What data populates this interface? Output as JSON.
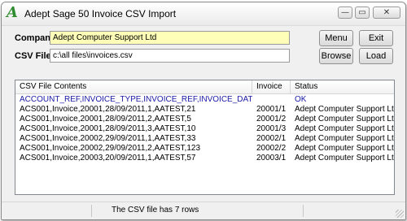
{
  "window": {
    "title": "Adept Sage 50 Invoice CSV Import",
    "icon": "adept-logo-icon"
  },
  "titlebar_buttons": {
    "minimize": "—",
    "restore": "▭",
    "close": "✕"
  },
  "form": {
    "company_label": "Company",
    "company_value": "Adept Computer Support Ltd",
    "csvfile_label": "CSV File",
    "csvfile_value": "c:\\all files\\invoices.csv"
  },
  "buttons": {
    "menu": "Menu",
    "exit": "Exit",
    "browse": "Browse",
    "load": "Load"
  },
  "table": {
    "columns": [
      "CSV File Contents",
      "Invoice",
      "Status"
    ],
    "rows": [
      {
        "contents": "ACCOUNT_REF,INVOICE_TYPE,INVOICE_REF,INVOICE_DATE,ITEM_N...",
        "invoice": "",
        "status": "OK",
        "highlight": true
      },
      {
        "contents": "ACS001,Invoice,20001,28/09/2011,1,AATEST,21",
        "invoice": "20001/1",
        "status": "Adept Computer Support Ltd"
      },
      {
        "contents": "ACS001,Invoice,20001,28/09/2011,2,AATEST,5",
        "invoice": "20001/2",
        "status": "Adept Computer Support Ltd"
      },
      {
        "contents": "ACS001,Invoice,20001,28/09/2011,3,AATEST,10",
        "invoice": "20001/3",
        "status": "Adept Computer Support Ltd"
      },
      {
        "contents": "ACS001,Invoice,20002,29/09/2011,1,AATEST,33",
        "invoice": "20002/1",
        "status": "Adept Computer Support Ltd"
      },
      {
        "contents": "ACS001,Invoice,20002,29/09/2011,2,AATEST,123",
        "invoice": "20002/2",
        "status": "Adept Computer Support Ltd"
      },
      {
        "contents": "ACS001,Invoice,20003,20/09/2011,1,AATEST,57",
        "invoice": "20003/1",
        "status": "Adept Computer Support Ltd"
      }
    ]
  },
  "statusbar": {
    "message": "The CSV file has 7 rows"
  },
  "colors": {
    "company_field_bg": "#fefeb8",
    "highlight_text": "#1a1aa6"
  }
}
